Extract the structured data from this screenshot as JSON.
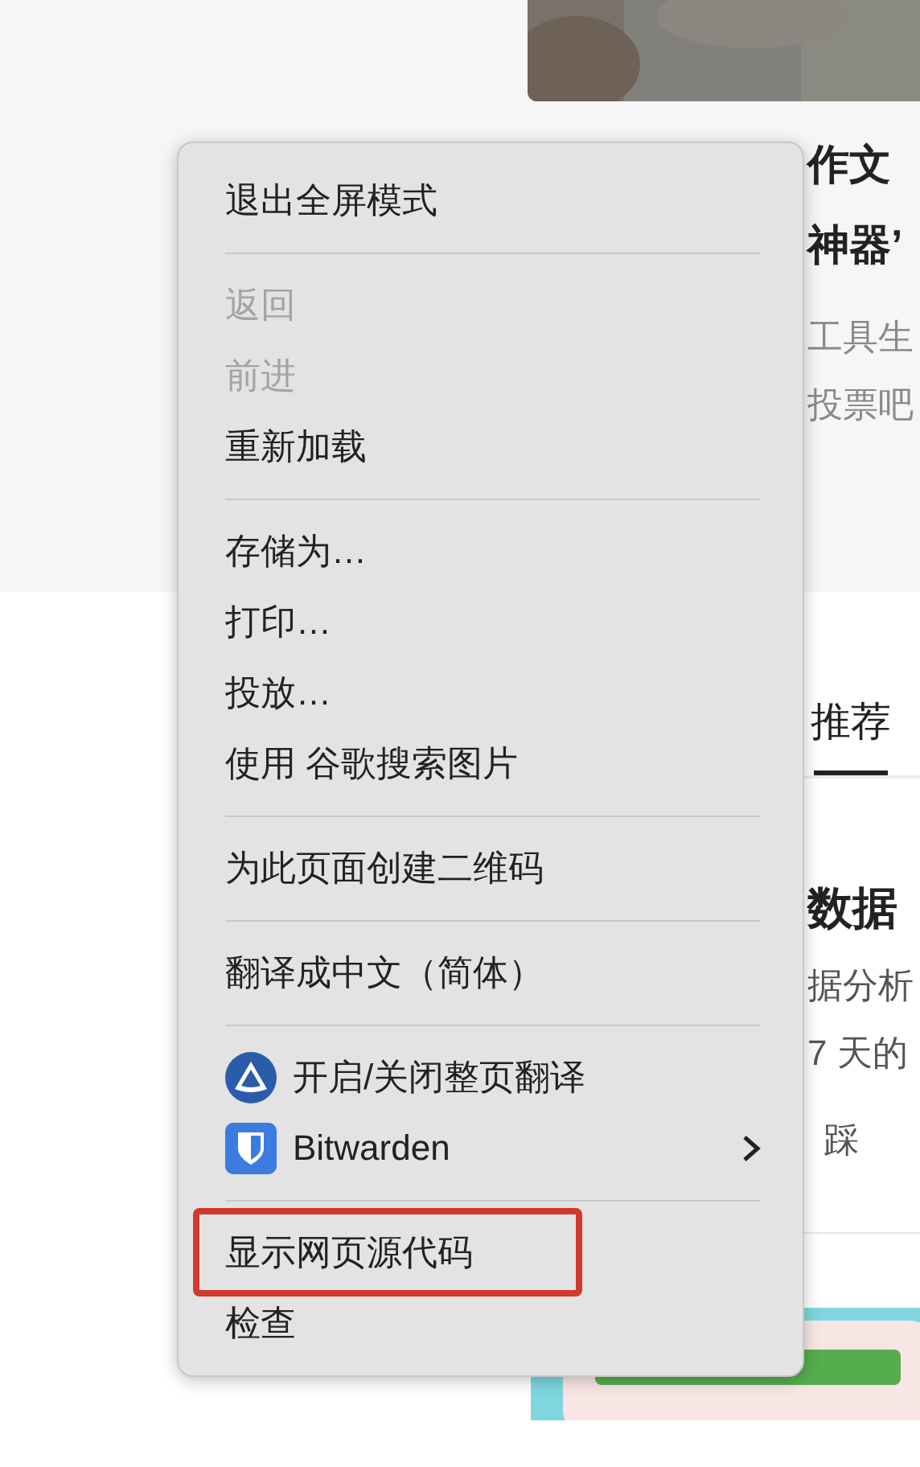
{
  "article": {
    "title_lines": [
      "作文",
      "神器’"
    ],
    "summary_lines": [
      "工具生",
      "投票吧"
    ]
  },
  "tabs": [
    {
      "label": "推荐",
      "selected": true
    }
  ],
  "post": {
    "title": "数据",
    "summary_lines": [
      "据分析",
      "7 天的"
    ],
    "action": "踩"
  },
  "context_menu": [
    {
      "kind": "item",
      "label": "退出全屏模式",
      "disabled": false,
      "highlighted": false,
      "submenu": false
    },
    {
      "kind": "separator"
    },
    {
      "kind": "item",
      "label": "返回",
      "disabled": true,
      "highlighted": false,
      "submenu": false
    },
    {
      "kind": "item",
      "label": "前进",
      "disabled": true,
      "highlighted": false,
      "submenu": false
    },
    {
      "kind": "item",
      "label": "重新加载",
      "disabled": false,
      "highlighted": false,
      "submenu": false
    },
    {
      "kind": "separator"
    },
    {
      "kind": "item",
      "label": "存储为…",
      "disabled": false,
      "highlighted": false,
      "submenu": false
    },
    {
      "kind": "item",
      "label": "打印…",
      "disabled": false,
      "highlighted": false,
      "submenu": false
    },
    {
      "kind": "item",
      "label": "投放…",
      "disabled": false,
      "highlighted": false,
      "submenu": false
    },
    {
      "kind": "item",
      "label": "使用 谷歌搜索图片",
      "disabled": false,
      "highlighted": false,
      "submenu": false
    },
    {
      "kind": "separator"
    },
    {
      "kind": "item",
      "label": "为此页面创建二维码",
      "disabled": false,
      "highlighted": false,
      "submenu": false
    },
    {
      "kind": "separator"
    },
    {
      "kind": "item",
      "label": "翻译成中文（简体）",
      "disabled": false,
      "highlighted": false,
      "submenu": false
    },
    {
      "kind": "separator"
    },
    {
      "kind": "translate_extension",
      "label": "开启/关闭整页翻译",
      "disabled": false,
      "highlighted": false,
      "submenu": false
    },
    {
      "kind": "password_extension",
      "label": "Bitwarden",
      "disabled": false,
      "highlighted": false,
      "submenu": true
    },
    {
      "kind": "separator"
    },
    {
      "kind": "item",
      "label": "显示网页源代码",
      "disabled": false,
      "highlighted": true,
      "submenu": false
    },
    {
      "kind": "item",
      "label": "检查",
      "disabled": false,
      "highlighted": false,
      "submenu": false
    }
  ]
}
